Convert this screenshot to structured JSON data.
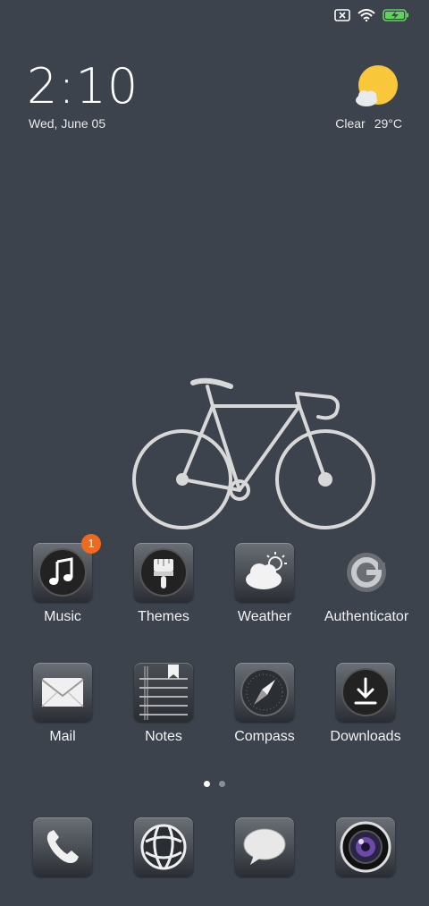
{
  "status_bar": {
    "icons": [
      "no-sim-icon",
      "wifi-icon",
      "battery-charging-icon"
    ]
  },
  "clock": {
    "time": "2:10",
    "date": "Wed, June 05"
  },
  "weather_widget": {
    "condition": "Clear",
    "temperature": "29°C",
    "icon": "partly-sunny-icon"
  },
  "apps_row1": [
    {
      "label": "Music",
      "badge": "1",
      "icon": "music-note-icon"
    },
    {
      "label": "Themes",
      "icon": "paintbrush-icon"
    },
    {
      "label": "Weather",
      "icon": "cloud-sun-icon"
    },
    {
      "label": "Authenticator",
      "icon": "authenticator-g-icon"
    }
  ],
  "apps_row2": [
    {
      "label": "Mail",
      "icon": "envelope-icon"
    },
    {
      "label": "Notes",
      "icon": "notepad-icon"
    },
    {
      "label": "Compass",
      "icon": "compass-icon"
    },
    {
      "label": "Downloads",
      "icon": "download-arrow-icon"
    }
  ],
  "page_indicator": {
    "pages": 2,
    "current": 1
  },
  "dock": [
    {
      "icon": "phone-icon"
    },
    {
      "icon": "browser-globe-icon"
    },
    {
      "icon": "chat-bubble-icon"
    },
    {
      "icon": "camera-lens-icon"
    }
  ],
  "colors": {
    "background": "#3d434c",
    "badge": "#f06a1c",
    "battery": "#5fd35a",
    "sun": "#f9c83a"
  }
}
